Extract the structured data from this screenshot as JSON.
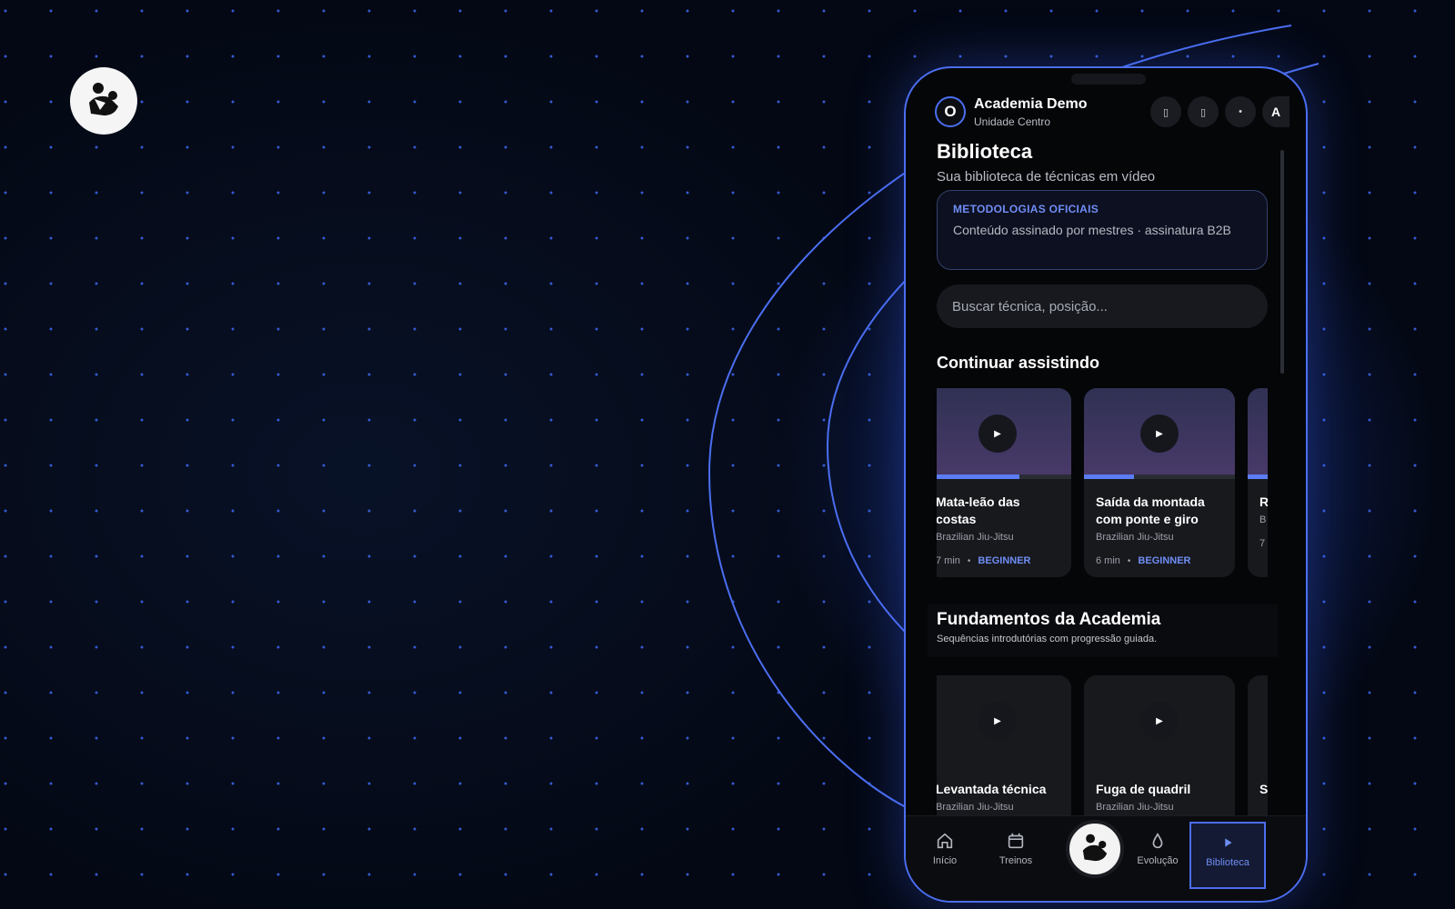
{
  "header": {
    "academy_initial": "O",
    "academy_name": "Academia Demo",
    "academy_unit": "Unidade Centro",
    "user_initial": "A"
  },
  "page": {
    "title": "Biblioteca",
    "subtitle": "Sua biblioteca de técnicas em vídeo"
  },
  "methodologies": {
    "tag": "METODOLOGIAS OFICIAIS",
    "description": "Conteúdo assinado por mestres · assinatura B2B"
  },
  "search": {
    "placeholder": "Buscar técnica, posição..."
  },
  "continue_watching": {
    "title": "Continuar assistindo",
    "cards": [
      {
        "title": "Mata-leão das costas",
        "sport": "Brazilian Jiu-Jitsu",
        "duration": "7 min",
        "level": "BEGINNER",
        "progress": 0.65
      },
      {
        "title": "Saída da montada com ponte e giro",
        "sport": "Brazilian Jiu-Jitsu",
        "duration": "6 min",
        "level": "BEGINNER",
        "progress": 0.33
      },
      {
        "title": "R",
        "sport": "B",
        "duration": "7",
        "level": "",
        "progress": 0.9
      }
    ]
  },
  "fundamentals": {
    "title": "Fundamentos da Academia",
    "subtitle": "Sequências introdutórias com progressão guiada.",
    "cards": [
      {
        "title": "Levantada técnica",
        "sport": "Brazilian Jiu-Jitsu"
      },
      {
        "title": "Fuga de quadril",
        "sport": "Brazilian Jiu-Jitsu"
      },
      {
        "title": "S",
        "sport": ""
      }
    ]
  },
  "nav": {
    "items": [
      {
        "label": "Início",
        "icon": "home-icon"
      },
      {
        "label": "Treinos",
        "icon": "calendar-icon"
      },
      {
        "label": "Evolução",
        "icon": "drop-icon"
      },
      {
        "label": "Biblioteca",
        "icon": "play-icon"
      }
    ],
    "active": "Biblioteca"
  },
  "colors": {
    "accent": "#4b6ef0",
    "accent_text": "#6f8df5",
    "background": "#040814"
  }
}
